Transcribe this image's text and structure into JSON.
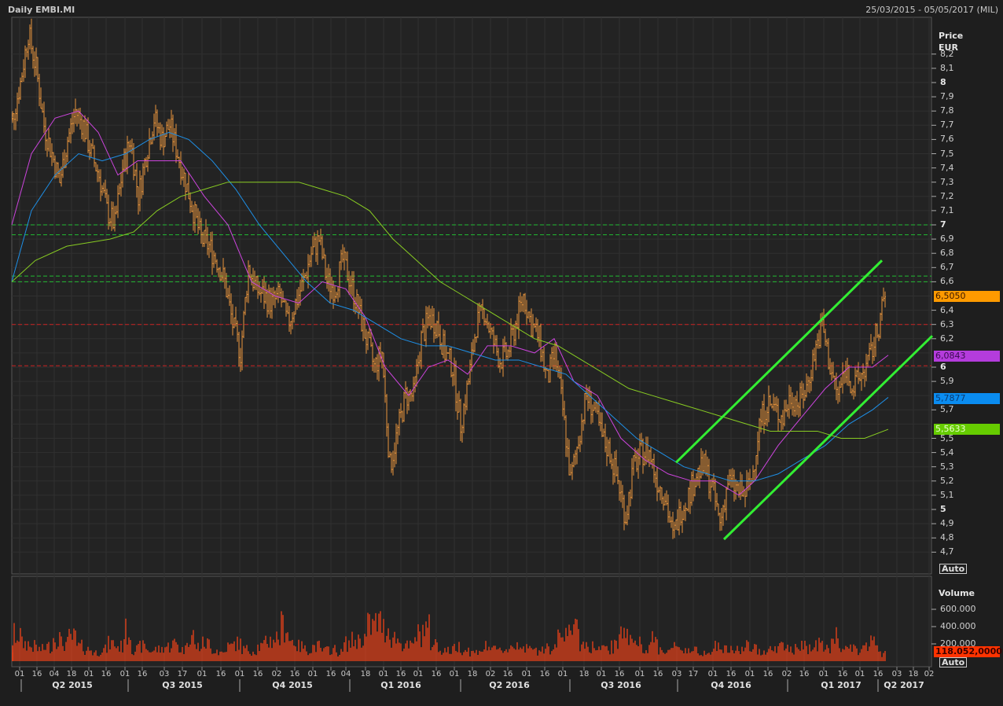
{
  "header": {
    "title": "Daily EMBI.MI",
    "date_range": "25/03/2015 - 05/05/2017 (MIL)"
  },
  "price_axis": {
    "title": "Price",
    "currency": "EUR",
    "ticks": [
      "8,2",
      "8,1",
      "8",
      "7,9",
      "7,8",
      "7,7",
      "7,6",
      "7,5",
      "7,4",
      "7,3",
      "7,2",
      "7,1",
      "7",
      "6,9",
      "6,8",
      "6,7",
      "6,6",
      "6,4",
      "6,3",
      "6,2",
      "6",
      "5,9",
      "5,7",
      "5,5",
      "5,4",
      "5,3",
      "5,2",
      "5,1",
      "5",
      "4,9",
      "4,8",
      "4,7"
    ],
    "auto_label": "Auto"
  },
  "volume_axis": {
    "title": "Volume",
    "ticks": [
      "600.000",
      "400.000",
      "200.000"
    ],
    "auto_label": "Auto"
  },
  "last_values": {
    "price": "6,5050",
    "ma_fast": "6,0843",
    "ma_mid": "5,7877",
    "ma_slow": "5,5633",
    "volume": "118.052,0000"
  },
  "x_axis": {
    "date_ticks": [
      "01",
      "16",
      "04",
      "18",
      "01",
      "16",
      "01",
      "16",
      "03",
      "17",
      "01",
      "16",
      "01",
      "16",
      "02",
      "16",
      "01",
      "16",
      "04",
      "18",
      "01",
      "16",
      "01",
      "16",
      "01",
      "18",
      "02",
      "16",
      "01",
      "16",
      "01",
      "18",
      "01",
      "16",
      "01",
      "16",
      "03",
      "17",
      "01",
      "16",
      "01",
      "16",
      "02",
      "16",
      "01",
      "16",
      "01",
      "16",
      "03",
      "18",
      "02"
    ],
    "quarters": [
      "Q2 2015",
      "Q3 2015",
      "Q4 2015",
      "Q1 2016",
      "Q2 2016",
      "Q3 2016",
      "Q4 2016",
      "Q1 2017",
      "Q2 2017"
    ]
  },
  "colors": {
    "background": "#1e1e1e",
    "grid": "#333333",
    "price_bar": "#e8943c",
    "ma_fast": "#cc44dd",
    "ma_mid": "#1e90e8",
    "ma_slow": "#88cc22",
    "trendline": "#33ee33",
    "support": "#22bb33",
    "resistance": "#cc2222",
    "volume": "#e0401a",
    "tag_price": "#ff9a00",
    "tag_fast": "#b43cdc",
    "tag_mid": "#0a8cf0",
    "tag_slow": "#66cc00",
    "tag_volume": "#ff3300"
  },
  "chart_data": {
    "type": "ohlc",
    "title": "Daily EMBI.MI",
    "x_unit": "weeks since 25/03/2015",
    "ylabel": "Price EUR",
    "ylim": [
      4.62,
      8.42
    ],
    "grid": true,
    "weekly_close": [
      7.75,
      8.0,
      8.35,
      8.1,
      7.7,
      7.5,
      7.3,
      7.6,
      7.8,
      7.7,
      7.5,
      7.35,
      7.1,
      7.0,
      7.4,
      7.6,
      7.2,
      7.5,
      7.75,
      7.6,
      7.7,
      7.5,
      7.3,
      7.1,
      6.9,
      6.85,
      6.75,
      6.6,
      6.3,
      6.1,
      6.7,
      6.55,
      6.5,
      6.45,
      6.5,
      6.3,
      6.45,
      6.6,
      6.8,
      6.9,
      6.6,
      6.55,
      6.75,
      6.6,
      6.4,
      6.2,
      6.0,
      6.1,
      5.3,
      5.55,
      5.8,
      5.8,
      6.2,
      6.35,
      6.3,
      6.1,
      6.0,
      5.6,
      5.9,
      6.3,
      6.4,
      6.2,
      6.05,
      6.1,
      6.3,
      6.5,
      6.3,
      6.2,
      5.9,
      6.1,
      5.7,
      5.2,
      5.5,
      5.8,
      5.7,
      5.5,
      5.4,
      5.2,
      4.95,
      5.3,
      5.4,
      5.4,
      5.2,
      5.1,
      4.8,
      5.0,
      5.1,
      5.25,
      5.3,
      5.15,
      4.9,
      5.2,
      5.15,
      5.1,
      5.2,
      5.6,
      5.75,
      5.7,
      5.65,
      5.8,
      5.75,
      5.85,
      6.1,
      6.3,
      6.0,
      5.8,
      6.0,
      5.85,
      5.95,
      6.05,
      6.25,
      6.505
    ],
    "moving_averages": [
      {
        "name": "fast",
        "last": 6.0843,
        "points": [
          [
            0,
            7.0
          ],
          [
            2.5,
            7.5
          ],
          [
            5.5,
            7.75
          ],
          [
            8.5,
            7.8
          ],
          [
            11,
            7.65
          ],
          [
            13.5,
            7.35
          ],
          [
            16,
            7.45
          ],
          [
            18.5,
            7.45
          ],
          [
            21.5,
            7.45
          ],
          [
            24.5,
            7.2
          ],
          [
            27.5,
            7.0
          ],
          [
            30.5,
            6.6
          ],
          [
            33.5,
            6.5
          ],
          [
            36.5,
            6.45
          ],
          [
            39.5,
            6.6
          ],
          [
            42.5,
            6.55
          ],
          [
            45,
            6.35
          ],
          [
            47.5,
            6.0
          ],
          [
            50.5,
            5.8
          ],
          [
            53,
            6.0
          ],
          [
            55.5,
            6.05
          ],
          [
            58,
            5.95
          ],
          [
            60.5,
            6.15
          ],
          [
            63.5,
            6.15
          ],
          [
            66.5,
            6.1
          ],
          [
            69,
            6.2
          ],
          [
            71.5,
            5.9
          ],
          [
            74.5,
            5.8
          ],
          [
            77.5,
            5.5
          ],
          [
            80.5,
            5.35
          ],
          [
            83.5,
            5.25
          ],
          [
            86.5,
            5.2
          ],
          [
            89.5,
            5.2
          ],
          [
            92.5,
            5.1
          ],
          [
            94.5,
            5.2
          ],
          [
            97.5,
            5.45
          ],
          [
            100.5,
            5.65
          ],
          [
            103.5,
            5.85
          ],
          [
            106.5,
            6.0
          ],
          [
            109.5,
            6.0
          ],
          [
            111.5,
            6.0843
          ]
        ]
      },
      {
        "name": "mid",
        "last": 5.7877,
        "points": [
          [
            0,
            6.6
          ],
          [
            2.5,
            7.1
          ],
          [
            5.5,
            7.35
          ],
          [
            8.5,
            7.5
          ],
          [
            11.5,
            7.45
          ],
          [
            14.5,
            7.5
          ],
          [
            17.5,
            7.6
          ],
          [
            20,
            7.65
          ],
          [
            22.5,
            7.6
          ],
          [
            25.5,
            7.45
          ],
          [
            28.5,
            7.25
          ],
          [
            31.5,
            7.0
          ],
          [
            34.5,
            6.8
          ],
          [
            37.5,
            6.6
          ],
          [
            40.5,
            6.45
          ],
          [
            43.5,
            6.4
          ],
          [
            46.5,
            6.3
          ],
          [
            49.5,
            6.2
          ],
          [
            52.5,
            6.15
          ],
          [
            55.5,
            6.15
          ],
          [
            58.5,
            6.1
          ],
          [
            61.5,
            6.05
          ],
          [
            64.5,
            6.05
          ],
          [
            67.5,
            6.0
          ],
          [
            70.5,
            5.95
          ],
          [
            73.5,
            5.8
          ],
          [
            76.5,
            5.65
          ],
          [
            79.5,
            5.5
          ],
          [
            82.5,
            5.4
          ],
          [
            85.5,
            5.3
          ],
          [
            88.5,
            5.25
          ],
          [
            91.5,
            5.2
          ],
          [
            94.5,
            5.2
          ],
          [
            97.5,
            5.25
          ],
          [
            100.5,
            5.35
          ],
          [
            103.5,
            5.45
          ],
          [
            106.5,
            5.6
          ],
          [
            109.5,
            5.7
          ],
          [
            111.5,
            5.7877
          ]
        ]
      },
      {
        "name": "slow",
        "last": 5.5633,
        "points": [
          [
            0,
            6.6
          ],
          [
            3,
            6.75
          ],
          [
            7,
            6.85
          ],
          [
            12.5,
            6.9
          ],
          [
            15.5,
            6.95
          ],
          [
            18.5,
            7.1
          ],
          [
            21.5,
            7.2
          ],
          [
            24.5,
            7.25
          ],
          [
            27.5,
            7.3
          ],
          [
            30.5,
            7.3
          ],
          [
            33.5,
            7.3
          ],
          [
            36.5,
            7.3
          ],
          [
            39.5,
            7.25
          ],
          [
            42.5,
            7.2
          ],
          [
            45.5,
            7.1
          ],
          [
            48.5,
            6.9
          ],
          [
            51.5,
            6.75
          ],
          [
            54.5,
            6.6
          ],
          [
            57.5,
            6.5
          ],
          [
            60.5,
            6.4
          ],
          [
            63.5,
            6.3
          ],
          [
            66.5,
            6.2
          ],
          [
            69.5,
            6.15
          ],
          [
            72.5,
            6.05
          ],
          [
            75.5,
            5.95
          ],
          [
            78.5,
            5.85
          ],
          [
            81.5,
            5.8
          ],
          [
            84.5,
            5.75
          ],
          [
            87.5,
            5.7
          ],
          [
            90.5,
            5.65
          ],
          [
            93.5,
            5.6
          ],
          [
            96.5,
            5.55
          ],
          [
            99.5,
            5.55
          ],
          [
            102.5,
            5.55
          ],
          [
            105.5,
            5.5
          ],
          [
            108.5,
            5.5
          ],
          [
            111.5,
            5.5633
          ]
        ]
      }
    ],
    "horizontal_levels": {
      "support": [
        7.0,
        6.93,
        6.64,
        6.6
      ],
      "resistance": [
        6.3,
        6.01
      ]
    },
    "trendlines": [
      [
        [
          84.5,
          5.33
        ],
        [
          110.7,
          6.75
        ]
      ],
      [
        [
          90.6,
          4.79
        ],
        [
          117.1,
          6.22
        ]
      ]
    ],
    "volume": {
      "ylim": [
        0,
        700000
      ],
      "weekly_peak_thousands": [
        200,
        450,
        300,
        250,
        200,
        250,
        400,
        300,
        400,
        250,
        200,
        150,
        200,
        300,
        250,
        500,
        200,
        250,
        180,
        200,
        250,
        300,
        200,
        450,
        250,
        300,
        200,
        150,
        250,
        300,
        200,
        180,
        250,
        350,
        400,
        600,
        350,
        250,
        200,
        250,
        180,
        200,
        150,
        300,
        350,
        400,
        600,
        650,
        550,
        400,
        300,
        250,
        450,
        550,
        300,
        200,
        180,
        250,
        200,
        150,
        200,
        250,
        180,
        200,
        250,
        300,
        200,
        180,
        250,
        200,
        400,
        650,
        500,
        300,
        250,
        200,
        200,
        250,
        650,
        400,
        300,
        250,
        350,
        200,
        180,
        250,
        200,
        180,
        150,
        200,
        250,
        200,
        180,
        200,
        250,
        200,
        180,
        200,
        250,
        220,
        200,
        250,
        220,
        300,
        200,
        400,
        250,
        200,
        180,
        250,
        350,
        118
      ]
    }
  }
}
